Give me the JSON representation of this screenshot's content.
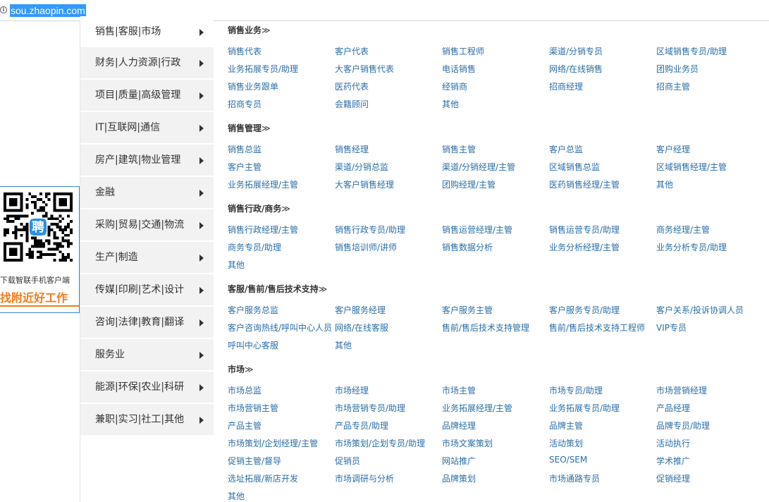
{
  "browser": {
    "url": "sou.zhaopin.com",
    "info_icon": "info-icon"
  },
  "categories": [
    "销售|客服|市场",
    "财务|人力资源|行政",
    "项目|质量|高级管理",
    "IT|互联网|通信",
    "房产|建筑|物业管理",
    "金融",
    "采购|贸易|交通|物流",
    "生产|制造",
    "传媒|印刷|艺术|设计",
    "咨询|法律|教育|翻译",
    "服务业",
    "能源|环保|农业|科研",
    "兼职|实习|社工|其他"
  ],
  "qr_panel": {
    "line1": "下载智联手机客户端",
    "line2": "找附近好工作"
  },
  "sections": [
    {
      "title": "销售业务",
      "chevron": "≫",
      "jobs": [
        "销售代表",
        "客户代表",
        "销售工程师",
        "渠道/分销专员",
        "区域销售专员/助理",
        "业务拓展专员/助理",
        "大客户销售代表",
        "电话销售",
        "网络/在线销售",
        "团购业务员",
        "销售业务跟单",
        "医药代表",
        "经销商",
        "招商经理",
        "招商主管",
        "招商专员",
        "会籍顾问",
        "其他"
      ]
    },
    {
      "title": "销售管理",
      "chevron": "≫",
      "jobs": [
        "销售总监",
        "销售经理",
        "销售主管",
        "客户总监",
        "客户经理",
        "客户主管",
        "渠道/分销总监",
        "渠道/分销经理/主管",
        "区域销售总监",
        "区域销售经理/主管",
        "业务拓展经理/主管",
        "大客户销售经理",
        "团购经理/主管",
        "医药销售经理/主管",
        "其他"
      ]
    },
    {
      "title": "销售行政/商务",
      "chevron": "≫",
      "jobs": [
        "销售行政经理/主管",
        "销售行政专员/助理",
        "销售运营经理/主管",
        "销售运营专员/助理",
        "商务经理/主管",
        "商务专员/助理",
        "销售培训师/讲师",
        "销售数据分析",
        "业务分析经理/主管",
        "业务分析专员/助理",
        "其他"
      ]
    },
    {
      "title": "客服/售前/售后技术支持",
      "chevron": "≫",
      "jobs": [
        "客户服务总监",
        "客户服务经理",
        "客户服务主管",
        "客户服务专员/助理",
        "客户关系/投诉协调人员",
        "客户咨询热线/呼叫中心人员",
        "网络/在线客服",
        "售前/售后技术支持管理",
        "售前/售后技术支持工程师",
        "VIP专员",
        "呼叫中心客服",
        "其他"
      ]
    },
    {
      "title": "市场",
      "chevron": "≫",
      "jobs": [
        "市场总监",
        "市场经理",
        "市场主管",
        "市场专员/助理",
        "市场营销经理",
        "市场营销主管",
        "市场营销专员/助理",
        "业务拓展经理/主管",
        "业务拓展专员/助理",
        "产品经理",
        "产品主管",
        "产品专员/助理",
        "品牌经理",
        "品牌主管",
        "品牌专员/助理",
        "市场策划/企划经理/主管",
        "市场策划/企划专员/助理",
        "市场文案策划",
        "活动策划",
        "活动执行",
        "促销主管/督导",
        "促销员",
        "网站推广",
        "SEO/SEM",
        "学术推广",
        "选址拓展/新店开发",
        "市场调研与分析",
        "品牌策划",
        "市场通路专员",
        "促销经理",
        "其他"
      ]
    }
  ]
}
